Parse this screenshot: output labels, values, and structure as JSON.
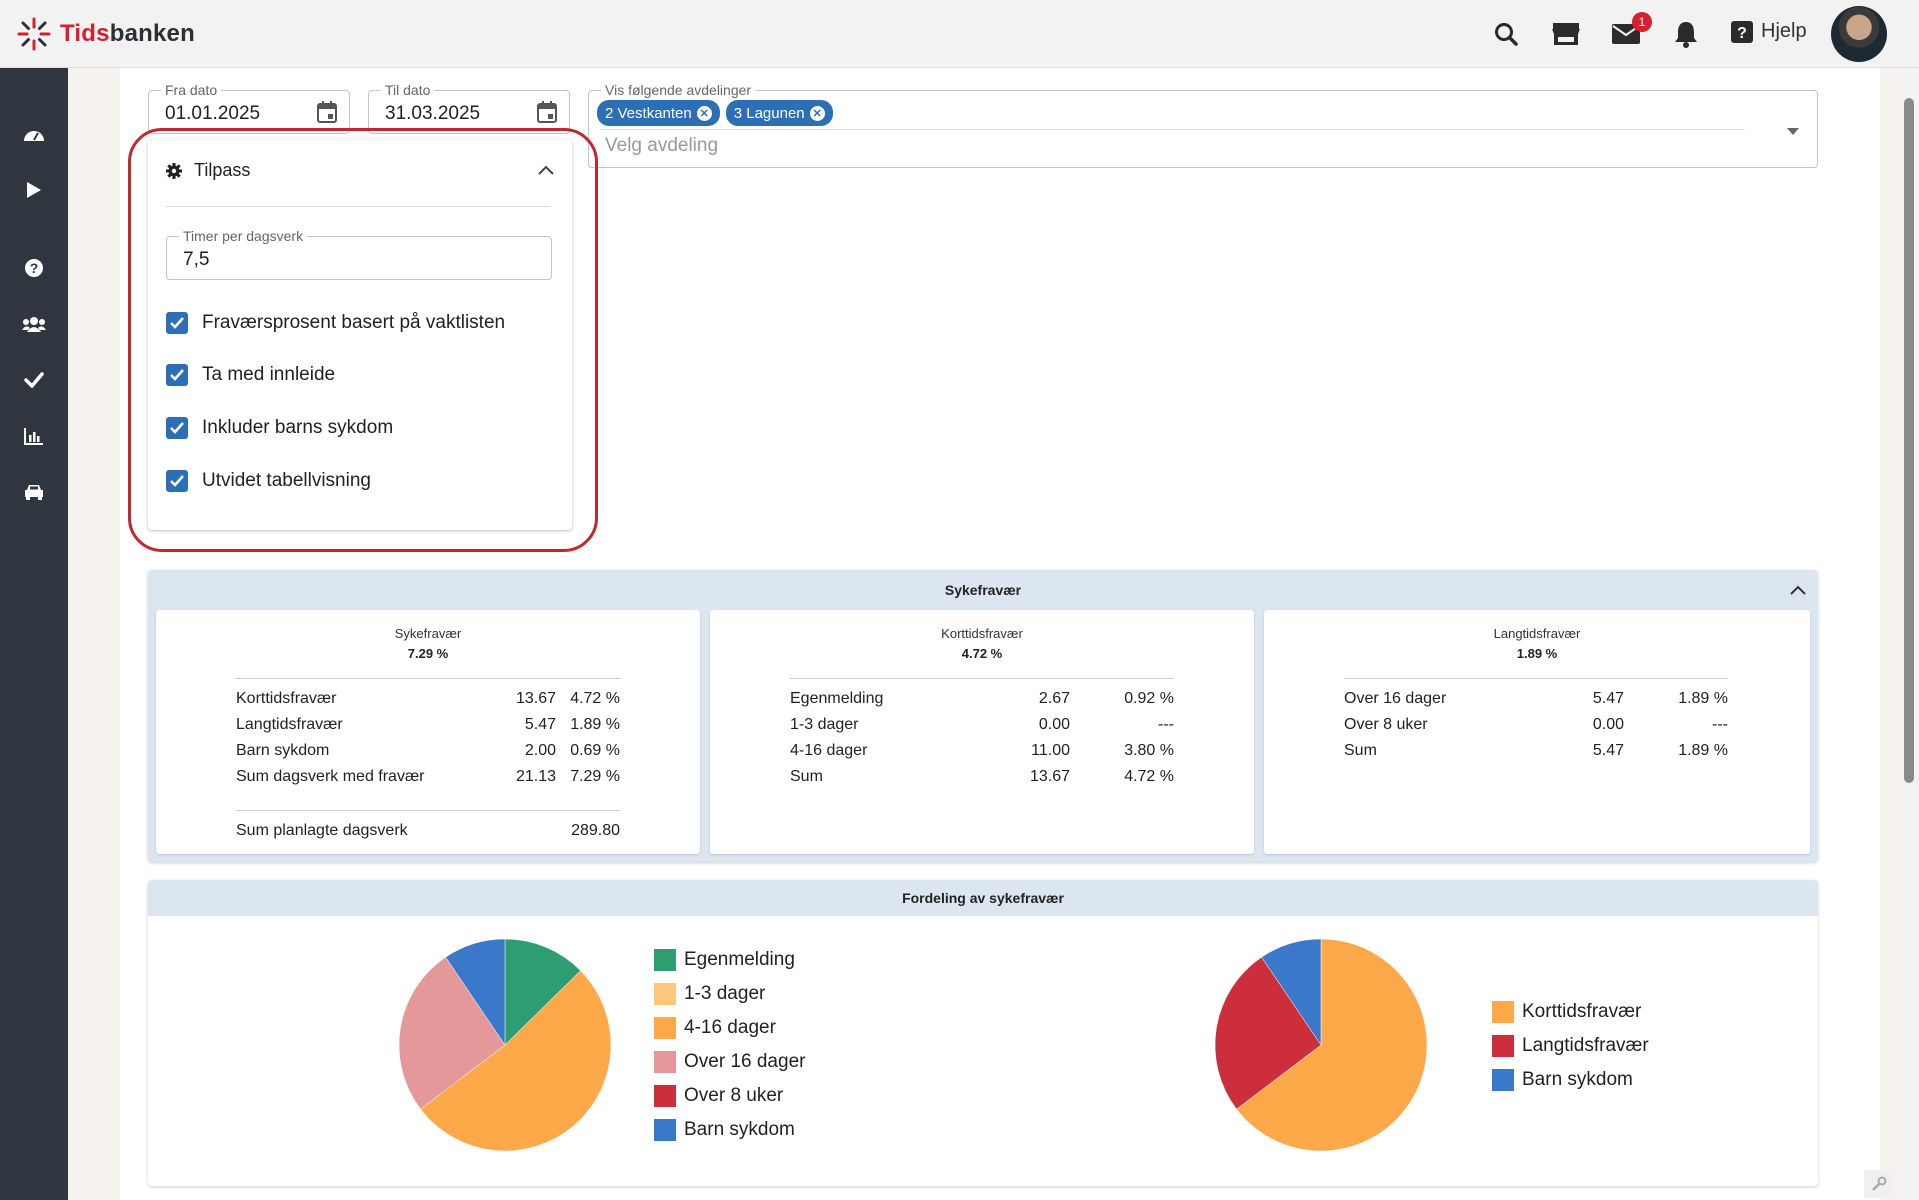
{
  "app": {
    "logo_pre": "Tids",
    "logo_post": "banken",
    "help_label": "Hjelp",
    "mail_badge": "1"
  },
  "filters": {
    "from_label": "Fra dato",
    "from_value": "01.01.2025",
    "to_label": "Til dato",
    "to_value": "31.03.2025",
    "dept_label": "Vis følgende avdelinger",
    "dept_chips": [
      "2 Vestkanten",
      "3 Lagunen"
    ],
    "dept_placeholder": "Velg avdeling"
  },
  "tilpass": {
    "title": "Tilpass",
    "hours_label": "Timer per dagsverk",
    "hours_value": "7,5",
    "checks": [
      "Fraværsprosent basert på vaktlisten",
      "Ta med innleide",
      "Inkluder barns sykdom",
      "Utvidet tabellvisning"
    ]
  },
  "sykefravaer": {
    "title": "Sykefravær",
    "cards": [
      {
        "title": "Sykefravær",
        "sub": "7.29 %",
        "rows": [
          [
            "Korttidsfravær",
            "13.67",
            "4.72 %"
          ],
          [
            "Langtidsfravær",
            "5.47",
            "1.89 %"
          ],
          [
            "Barn sykdom",
            "2.00",
            "0.69 %"
          ],
          [
            "Sum dagsverk med fravær",
            "21.13",
            "7.29 %"
          ]
        ],
        "footer": [
          "Sum planlagte dagsverk",
          "289.80"
        ]
      },
      {
        "title": "Korttidsfravær",
        "sub": "4.72 %",
        "rows": [
          [
            "Egenmelding",
            "2.67",
            "0.92 %"
          ],
          [
            "1-3 dager",
            "0.00",
            "---"
          ],
          [
            "4-16 dager",
            "11.00",
            "3.80 %"
          ],
          [
            "Sum",
            "13.67",
            "4.72 %"
          ]
        ]
      },
      {
        "title": "Langtidsfravær",
        "sub": "1.89 %",
        "rows": [
          [
            "Over 16 dager",
            "5.47",
            "1.89 %"
          ],
          [
            "Over 8 uker",
            "0.00",
            "---"
          ],
          [
            "Sum",
            "5.47",
            "1.89 %"
          ]
        ]
      }
    ]
  },
  "fordeling": {
    "title": "Fordeling av sykefravær"
  },
  "colors": {
    "green": "#2e9e72",
    "light_orange": "#fdc77d",
    "orange": "#fda94a",
    "pink": "#e49899",
    "red": "#cc2f3b",
    "blue": "#3a78c9"
  },
  "chart_data": [
    {
      "type": "pie",
      "labels": [
        "Egenmelding",
        "1-3 dager",
        "4-16 dager",
        "Over 16 dager",
        "Over 8 uker",
        "Barn sykdom"
      ],
      "values": [
        2.67,
        0.0,
        11.0,
        5.47,
        0.0,
        2.0
      ]
    },
    {
      "type": "pie",
      "labels": [
        "Korttidsfravær",
        "Langtidsfravær",
        "Barn sykdom"
      ],
      "values": [
        13.67,
        5.47,
        2.0
      ]
    }
  ]
}
